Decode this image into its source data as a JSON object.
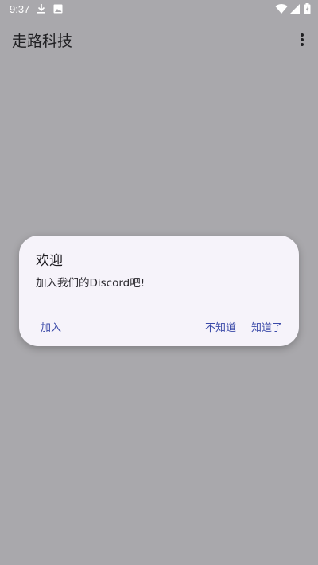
{
  "status_bar": {
    "time": "9:37",
    "icons": [
      "download-icon",
      "image-icon",
      "wifi-icon",
      "signal-icon",
      "battery-icon"
    ]
  },
  "app_bar": {
    "title": "走路科技",
    "menu_icon": "more-vert-icon"
  },
  "dialog": {
    "title": "欢迎",
    "message": "加入我们的Discord吧!",
    "buttons": {
      "join": "加入",
      "dont_know": "不知道",
      "know": "知道了"
    }
  },
  "colors": {
    "scrim": "#a9a8ac",
    "dialog_bg": "#f6f3fa",
    "accent": "#3a49a8",
    "status_text": "#ffffff"
  }
}
